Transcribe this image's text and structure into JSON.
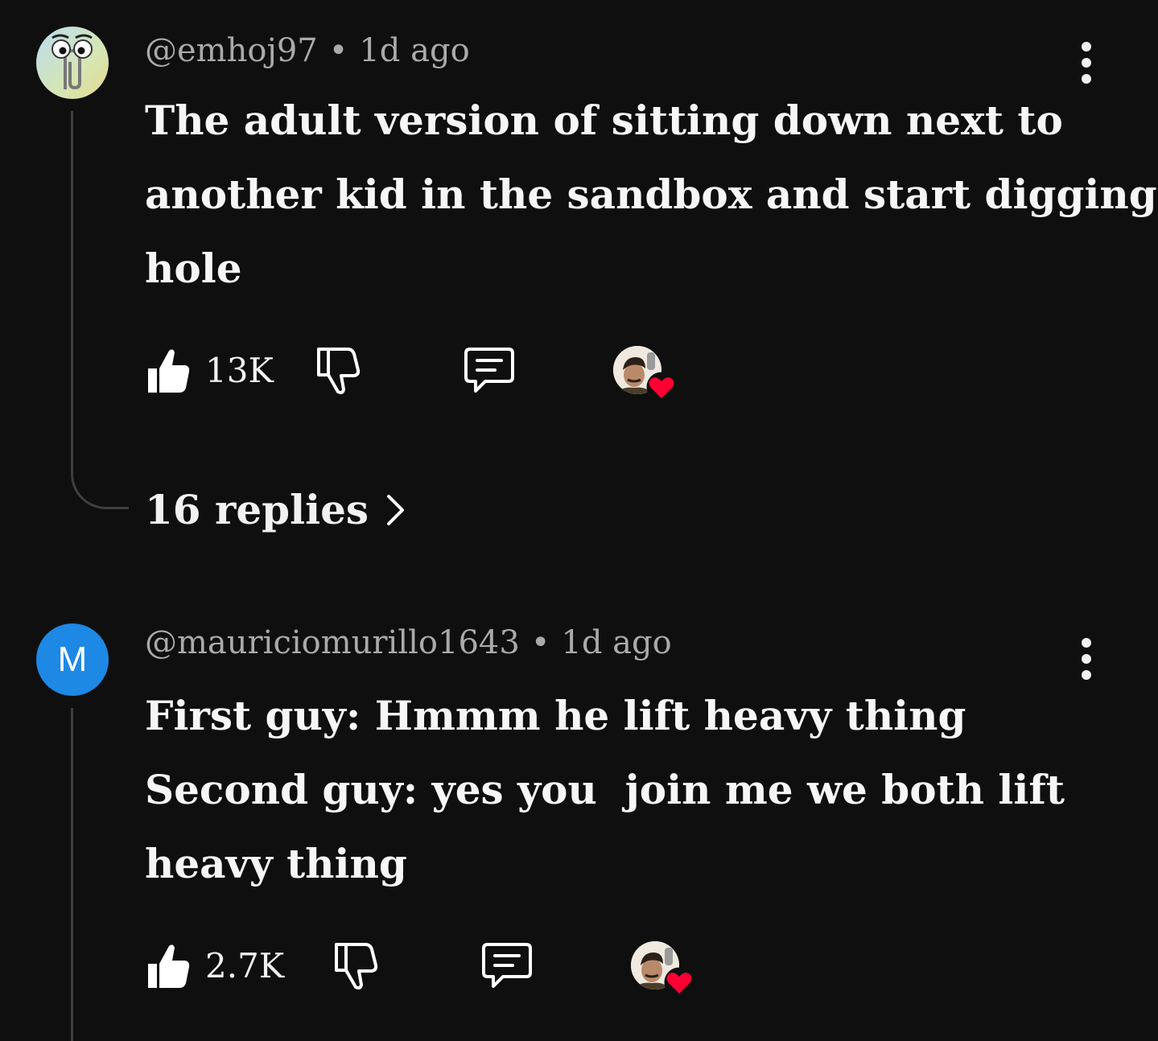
{
  "comments": [
    {
      "avatar": "clippy-avatar",
      "handle": "@emhoj97",
      "separator": "•",
      "time": "1d ago",
      "body_lines": [
        "The adult version of sitting down next to",
        "another kid in the sandbox and start digging a",
        "hole"
      ],
      "likes": "13K",
      "replies_label": "16 replies",
      "creator_heart": true
    },
    {
      "avatar_letter": "M",
      "avatar_color": "#1e88e5",
      "handle": "@mauriciomurillo1643",
      "separator": "•",
      "time": "1d ago",
      "body_lines": [
        "First guy: Hmmm he lift heavy thing",
        "Second guy: yes you  join me we both lift",
        "heavy thing"
      ],
      "likes": "2.7K",
      "creator_heart": true
    }
  ],
  "icons": {
    "more": "kebab-menu-icon",
    "like": "thumbs-up-filled-icon",
    "dislike": "thumbs-down-outline-icon",
    "reply": "comment-bubble-icon",
    "heart": "creator-heart-icon",
    "chevron": "chevron-right-icon"
  },
  "colors": {
    "background": "#0f0f0f",
    "text": "#f1f1f1",
    "meta": "#aaaaaa",
    "heart": "#ff0033",
    "avatar_m": "#1e88e5"
  }
}
